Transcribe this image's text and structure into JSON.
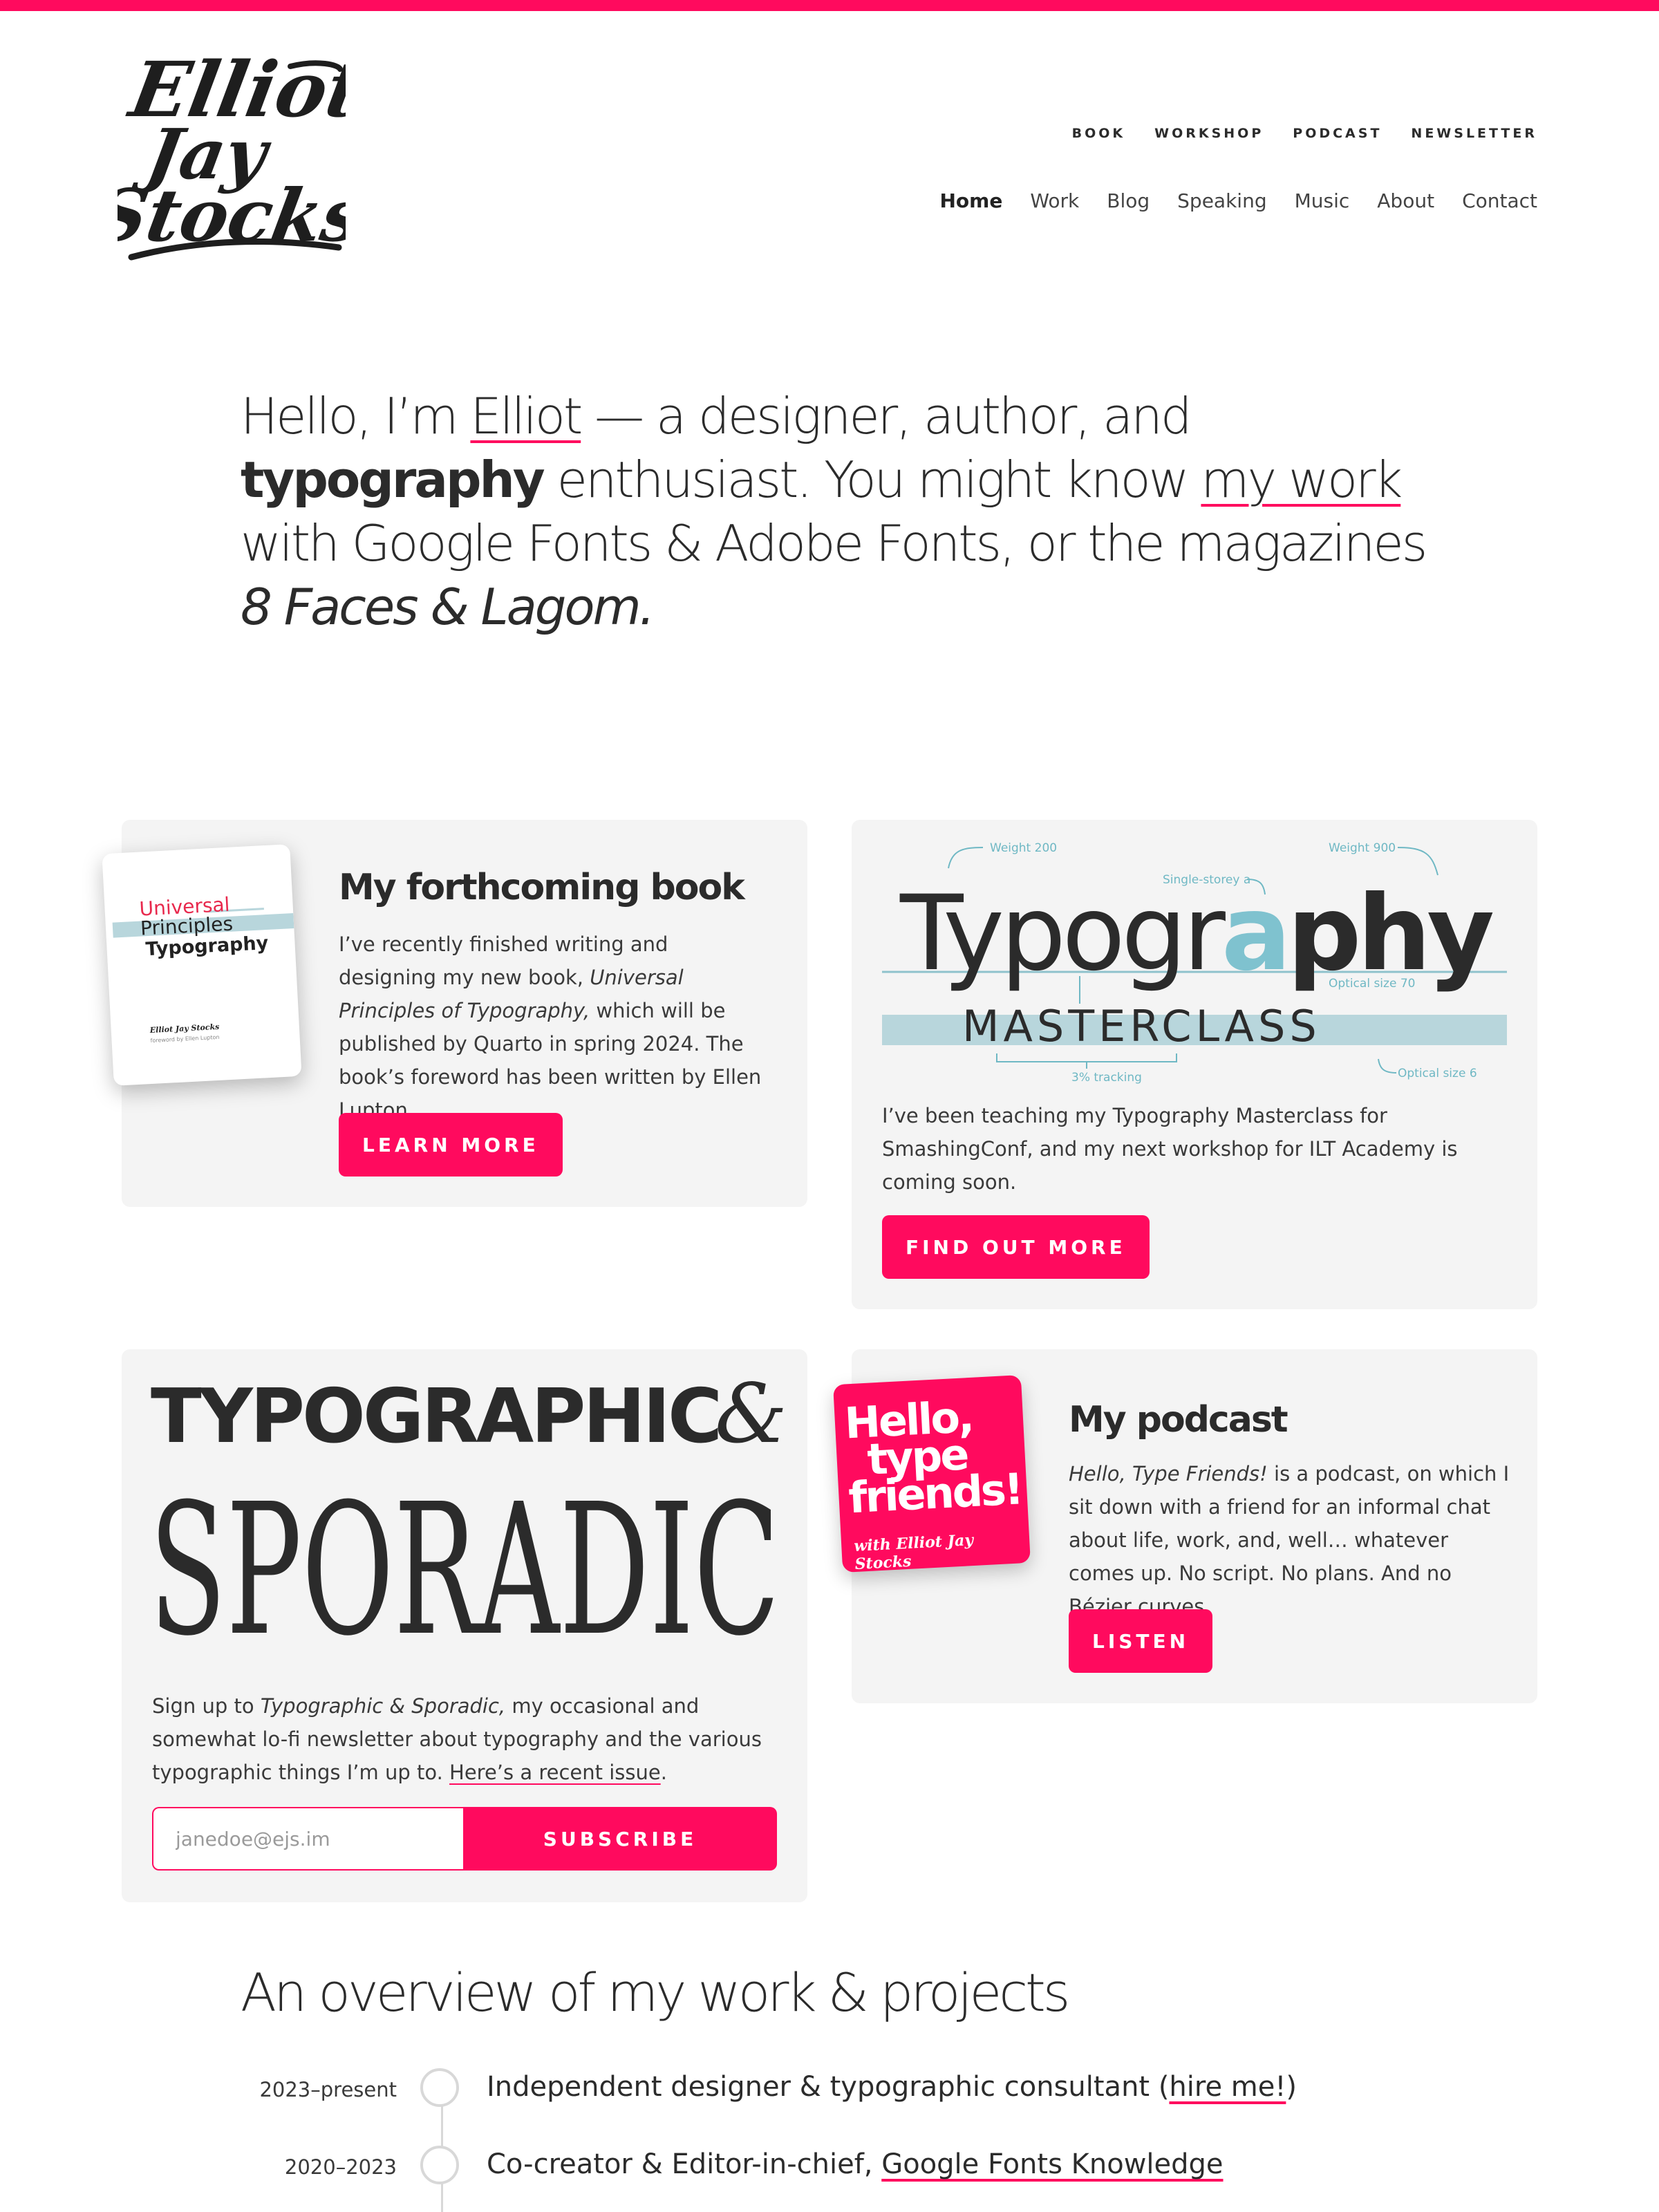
{
  "brand": {
    "logo_text": "Elliot Jay Stocks",
    "accent": "#ff0a5e"
  },
  "secondary_nav": [
    "BOOK",
    "WORKSHOP",
    "PODCAST",
    "NEWSLETTER"
  ],
  "main_nav": {
    "active": "Home",
    "items": [
      "Home",
      "Work",
      "Blog",
      "Speaking",
      "Music",
      "About",
      "Contact"
    ]
  },
  "hero": {
    "p1": "Hello, I’m ",
    "link1": "Elliot",
    "p2": " — a designer, author, and ",
    "bold": "typography",
    "p3": " enthusiast. You might know ",
    "link2": "my work",
    "p4": " with Google Fonts & Adobe Fonts, or the magazines ",
    "italic": "8 Faces & Lagom."
  },
  "book_card": {
    "title": "My forthcoming book",
    "text_a": "I’ve recently finished writing and designing my new book, ",
    "text_italic": "Universal Principles of Typography,",
    "text_b": " which will be published by Quarto in spring 2024. The book’s foreword has been written by Ellen Lupton.",
    "button": "LEARN MORE",
    "cover": {
      "line1": "Universal",
      "line2": "Principles",
      "line3": "Typography",
      "author": "Elliot Jay Stocks",
      "foreword": "foreword by Ellen Lupton"
    }
  },
  "workshop_card": {
    "art": {
      "word": "Typography",
      "word_part1": "Typogr",
      "word_part2": "a",
      "word_part3": "phy",
      "sub": "MASTERCLASS",
      "ann_weight200": "Weight 200",
      "ann_weight900": "Weight 900",
      "ann_single": "Single-storey a",
      "ann_optical70": "Optical size 70",
      "ann_tracking": "3% tracking",
      "ann_optical6": "Optical size 6"
    },
    "text": "I’ve been teaching my Typography Masterclass for SmashingConf, and my next workshop for ILT Academy is coming soon.",
    "button": "FIND OUT MORE"
  },
  "newsletter_card": {
    "title_line1": "TYPOGRAPHIC",
    "title_amp": "&",
    "title_line2": "SPORADIC",
    "text_a": "Sign up to ",
    "text_italic": "Typographic & Sporadic,",
    "text_b": " my occasional and somewhat lo-fi newsletter about typography and the various typographic things I’m up to. ",
    "link": "Here’s a recent issue",
    "text_end": ".",
    "email_placeholder": "janedoe@ejs.im",
    "button": "SUBSCRIBE"
  },
  "podcast_card": {
    "title": "My podcast",
    "art_line1": "Hello,",
    "art_line2": "type",
    "art_line3": "friends!",
    "art_sub": "with Elliot Jay Stocks",
    "text_italic": "Hello, Type Friends!",
    "text": " is a podcast, on which I sit down with a friend for an informal chat about life, work, and, well… whatever comes up. No script. No plans. And no Bézier curves.",
    "button": "LISTEN"
  },
  "overview": {
    "title": "An overview of my work & projects",
    "items": [
      {
        "years": "2023–present",
        "text_a": "Independent designer & typographic consultant (",
        "link": "hire me!",
        "text_b": ")"
      },
      {
        "years": "2020–2023",
        "text_a": "Co-creator & Editor-in-chief, ",
        "link": "Google Fonts Knowledge",
        "text_b": ""
      }
    ]
  }
}
